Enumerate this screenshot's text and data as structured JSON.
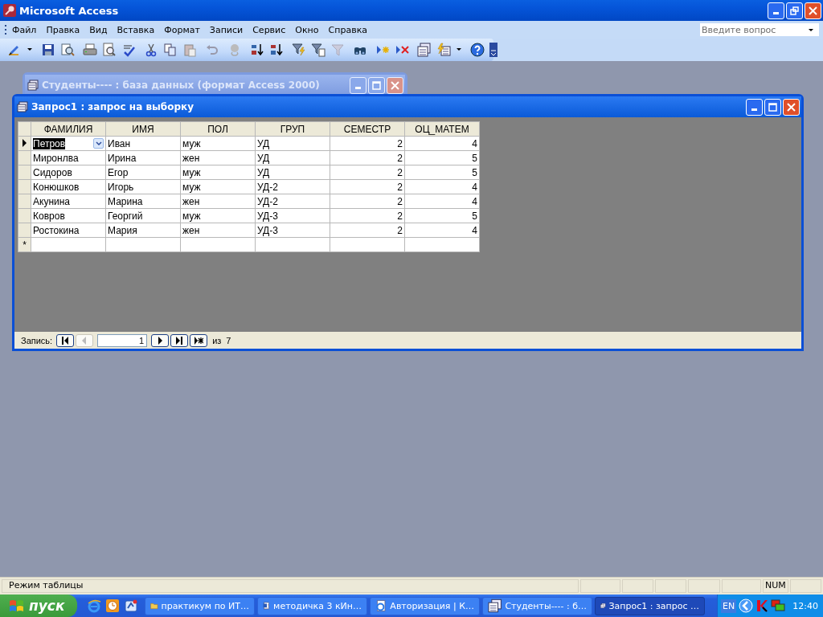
{
  "app": {
    "title": "Microsoft Access"
  },
  "menu": [
    {
      "label": "Файл"
    },
    {
      "label": "Правка"
    },
    {
      "label": "Вид"
    },
    {
      "label": "Вставка"
    },
    {
      "label": "Формат"
    },
    {
      "label": "Записи"
    },
    {
      "label": "Сервис"
    },
    {
      "label": "Окно"
    },
    {
      "label": "Справка"
    }
  ],
  "help_search": {
    "placeholder": "Введите вопрос"
  },
  "database_window": {
    "title": "Студенты---- : база данных (формат Access 2000)",
    "active": false
  },
  "query_window": {
    "title": "Запрос1 : запрос на выборку",
    "active": true,
    "table": {
      "columns": [
        {
          "label": "ФАМИЛИЯ",
          "kind": "text"
        },
        {
          "label": "ИМЯ",
          "kind": "text"
        },
        {
          "label": "ПОЛ",
          "kind": "text"
        },
        {
          "label": "ГРУП",
          "kind": "text"
        },
        {
          "label": "СЕМЕСТР",
          "kind": "number"
        },
        {
          "label": "ОЦ_МАТЕМ",
          "kind": "number"
        }
      ],
      "rows": [
        {
          "current": true,
          "cells": [
            "Петров",
            "Иван",
            "муж",
            "УД",
            "2",
            "4"
          ]
        },
        {
          "current": false,
          "cells": [
            "Миронлва",
            "Ирина",
            "жен",
            "УД",
            "2",
            "5"
          ]
        },
        {
          "current": false,
          "cells": [
            "Сидоров",
            "Егор",
            "муж",
            "УД",
            "2",
            "5"
          ]
        },
        {
          "current": false,
          "cells": [
            "Конюшков",
            "Игорь",
            "муж",
            "УД-2",
            "2",
            "4"
          ]
        },
        {
          "current": false,
          "cells": [
            "Акунина",
            "Марина",
            "жен",
            "УД-2",
            "2",
            "4"
          ]
        },
        {
          "current": false,
          "cells": [
            "Ковров",
            "Георгий",
            "муж",
            "УД-3",
            "2",
            "5"
          ]
        },
        {
          "current": false,
          "cells": [
            "Ростокина",
            "Мария",
            "жен",
            "УД-3",
            "2",
            "4"
          ]
        }
      ],
      "new_row_marker": "*"
    },
    "navigation": {
      "label": "Запись:",
      "record": "1",
      "of": "из",
      "count": "7"
    }
  },
  "status_bar": {
    "mode": "Режим таблицы",
    "indicator": "NUM"
  },
  "taskbar": {
    "start": "пуск",
    "tasks": [
      {
        "label": "практикум по ИТ…",
        "kind": "folder",
        "selected": false
      },
      {
        "label": "методичка 3 кИн…",
        "kind": "document",
        "selected": false
      },
      {
        "label": "Авторизация | К…",
        "kind": "browser",
        "selected": false
      },
      {
        "label": "Студенты---- : б…",
        "kind": "database",
        "selected": false
      },
      {
        "label": "Запрос1 : запрос …",
        "kind": "database",
        "selected": true
      }
    ],
    "language": "EN",
    "clock": "12:40"
  }
}
